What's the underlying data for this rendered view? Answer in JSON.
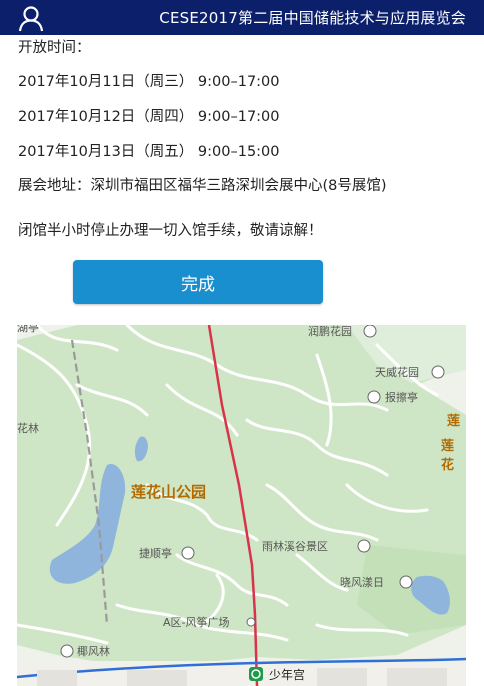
{
  "header": {
    "title": "CESE2017第二届中国储能技术与应用展览会"
  },
  "info": {
    "hours_label": "开放时间：",
    "schedule": [
      "2017年10月11日（周三） 9:00–17:00",
      "2017年10月12日（周四） 9:00–17:00",
      "2017年10月13日（周五） 9:00–15:00"
    ],
    "address": "展会地址：深圳市福田区福华三路深圳会展中心(8号展馆)",
    "notice": "闭馆半小时停止办理一切入馆手续，敬请谅解！"
  },
  "actions": {
    "done_label": "完成"
  },
  "map": {
    "labels": {
      "park": "莲花山公园",
      "runhua": "润鹏花园",
      "tianwei": "天威花园",
      "baozhang": "报擦亭",
      "lian1": "莲",
      "lian2": "莲花",
      "hualin": "花林",
      "jieshun": "捷顺亭",
      "yulin": "雨林溪谷景区",
      "xiaofeng": "晓风漾日",
      "fengzheng": "A区-风筝广场",
      "yefeng": "椰风林",
      "shaonian": "少年宫",
      "topleft": "湖亭"
    },
    "colors": {
      "park_fill": "#cfe6c6",
      "water": "#8fb5dc",
      "metro_red": "#d8334a",
      "metro_blue": "#2f6fd6"
    }
  }
}
